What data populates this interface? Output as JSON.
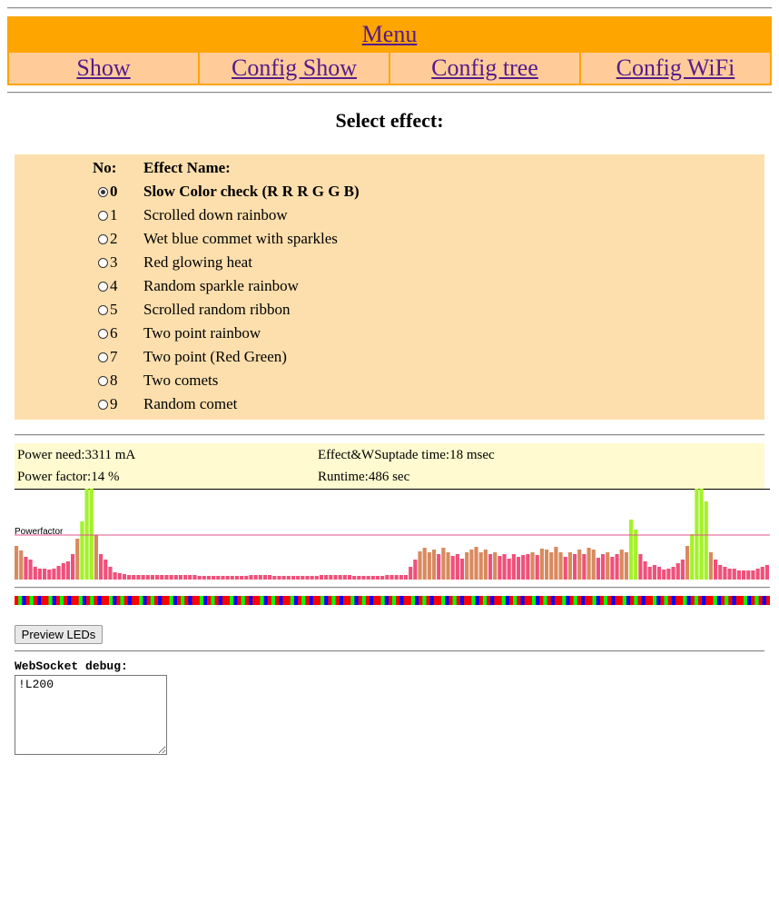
{
  "nav": {
    "menu_label": "Menu",
    "tabs": [
      {
        "label": "Show"
      },
      {
        "label": "Config Show"
      },
      {
        "label": "Config tree"
      },
      {
        "label": "Config WiFi"
      }
    ]
  },
  "page": {
    "title": "Select effect:"
  },
  "effects": {
    "header_no": "No:",
    "header_name": "Effect Name:",
    "selected": 0,
    "items": [
      {
        "no": "0",
        "name": "Slow Color check (R R R G G B)"
      },
      {
        "no": "1",
        "name": "Scrolled down rainbow"
      },
      {
        "no": "2",
        "name": "Wet blue commet with sparkles"
      },
      {
        "no": "3",
        "name": "Red glowing heat"
      },
      {
        "no": "4",
        "name": "Random sparkle rainbow"
      },
      {
        "no": "5",
        "name": "Scrolled random ribbon"
      },
      {
        "no": "6",
        "name": "Two point rainbow"
      },
      {
        "no": "7",
        "name": "Two point (Red Green)"
      },
      {
        "no": "8",
        "name": "Two comets"
      },
      {
        "no": "9",
        "name": "Random comet"
      }
    ]
  },
  "stats": {
    "power_need": "Power need:3311 mA",
    "power_factor": "Power factor:14 %",
    "update_time": "Effect&WSuptade time:18 msec",
    "runtime": "Runtime:486 sec"
  },
  "chart_data": {
    "type": "bar",
    "ylabel": "",
    "ylim": [
      0,
      100
    ],
    "threshold_label": "Powerfactor",
    "threshold": 49,
    "values": [
      37,
      32,
      25,
      22,
      14,
      12,
      12,
      11,
      12,
      15,
      18,
      20,
      28,
      45,
      64,
      100,
      100,
      49,
      28,
      22,
      14,
      8,
      7,
      6,
      5,
      5,
      5,
      5,
      5,
      5,
      5,
      5,
      5,
      5,
      5,
      5,
      5,
      5,
      5,
      4,
      4,
      4,
      4,
      4,
      4,
      4,
      4,
      4,
      4,
      4,
      5,
      5,
      5,
      5,
      5,
      4,
      4,
      4,
      4,
      4,
      4,
      4,
      4,
      4,
      4,
      5,
      5,
      5,
      5,
      5,
      5,
      5,
      4,
      4,
      4,
      4,
      4,
      4,
      4,
      5,
      5,
      5,
      5,
      5,
      14,
      22,
      31,
      35,
      30,
      33,
      28,
      35,
      30,
      26,
      28,
      23,
      30,
      33,
      36,
      30,
      33,
      28,
      30,
      26,
      28,
      23,
      28,
      25,
      27,
      28,
      30,
      27,
      34,
      33,
      30,
      36,
      30,
      25,
      30,
      28,
      33,
      28,
      35,
      33,
      24,
      28,
      30,
      25,
      28,
      33,
      30,
      66,
      55,
      28,
      20,
      14,
      16,
      14,
      11,
      12,
      14,
      18,
      22,
      37,
      50,
      100,
      100,
      86,
      30,
      22,
      16,
      14,
      12,
      12,
      10,
      10,
      10,
      10,
      12,
      14,
      16
    ],
    "bar_colors": {
      "low": "#f0507a",
      "mid": "#d88a5e",
      "high": "#a3f227"
    },
    "threshold_color": "#e0508a"
  },
  "led_strip": {
    "colors": [
      "#ff0000",
      "#00ff00",
      "#0000ff",
      "#ff0000",
      "#00ff00",
      "#ff0000",
      "#0000ff",
      "#ff0000"
    ],
    "count": 200
  },
  "controls": {
    "preview_label": "Preview LEDs"
  },
  "debug": {
    "label": "WebSocket debug:",
    "content": "!L200"
  }
}
